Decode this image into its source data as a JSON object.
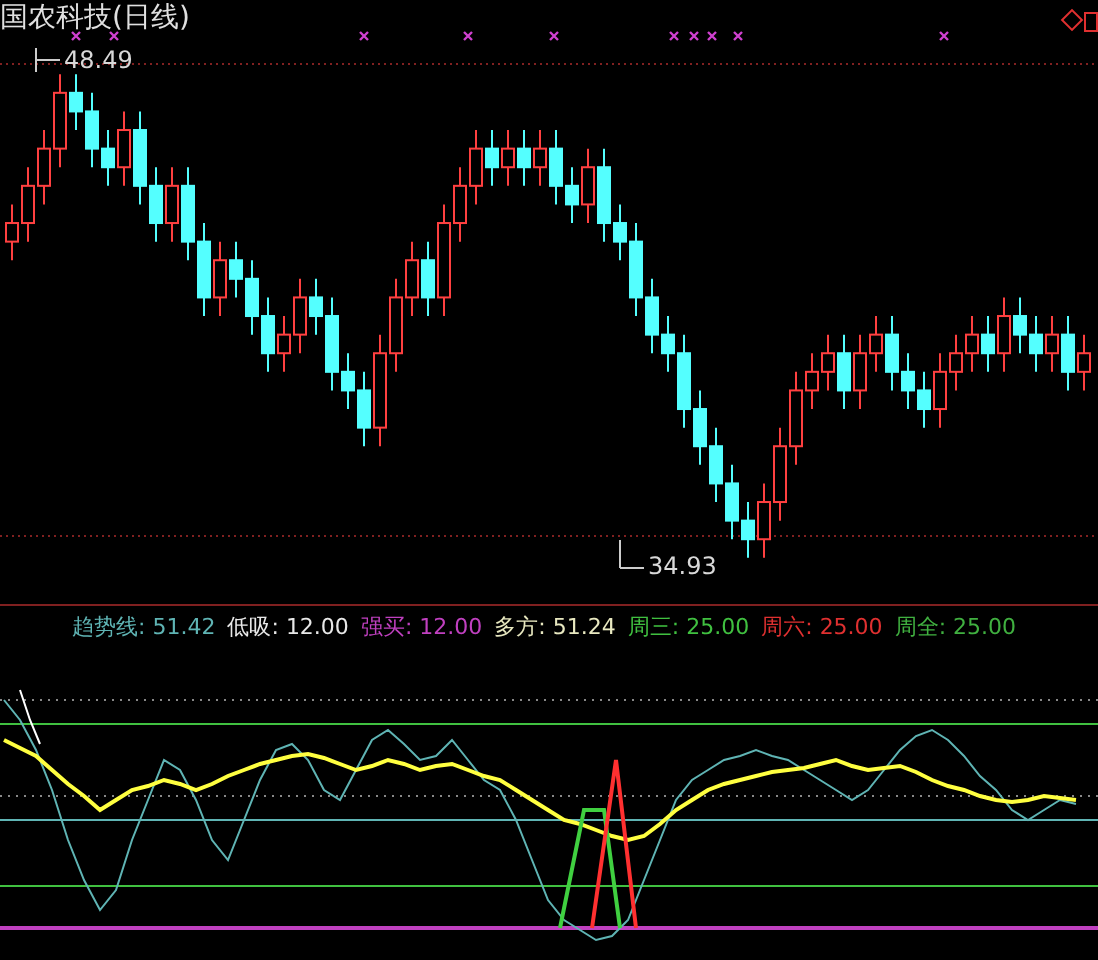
{
  "chart_title": "国农科技(日线)",
  "high_label": "48.49",
  "low_label": "34.93",
  "legend": [
    {
      "label": "趋势线:",
      "value": "51.42",
      "color": "#5fb4b4"
    },
    {
      "label": "低吸:",
      "value": "12.00",
      "color": "#e8e8e8"
    },
    {
      "label": "强买:",
      "value": "12.00",
      "color": "#c040c0"
    },
    {
      "label": "多方:",
      "value": "51.24",
      "color": "#e8e8c0"
    },
    {
      "label": "周三:",
      "value": "25.00",
      "color": "#40c040"
    },
    {
      "label": "周六:",
      "value": "25.00",
      "color": "#e03030"
    },
    {
      "label": "周全:",
      "value": "25.00",
      "color": "#40b040"
    }
  ]
}
